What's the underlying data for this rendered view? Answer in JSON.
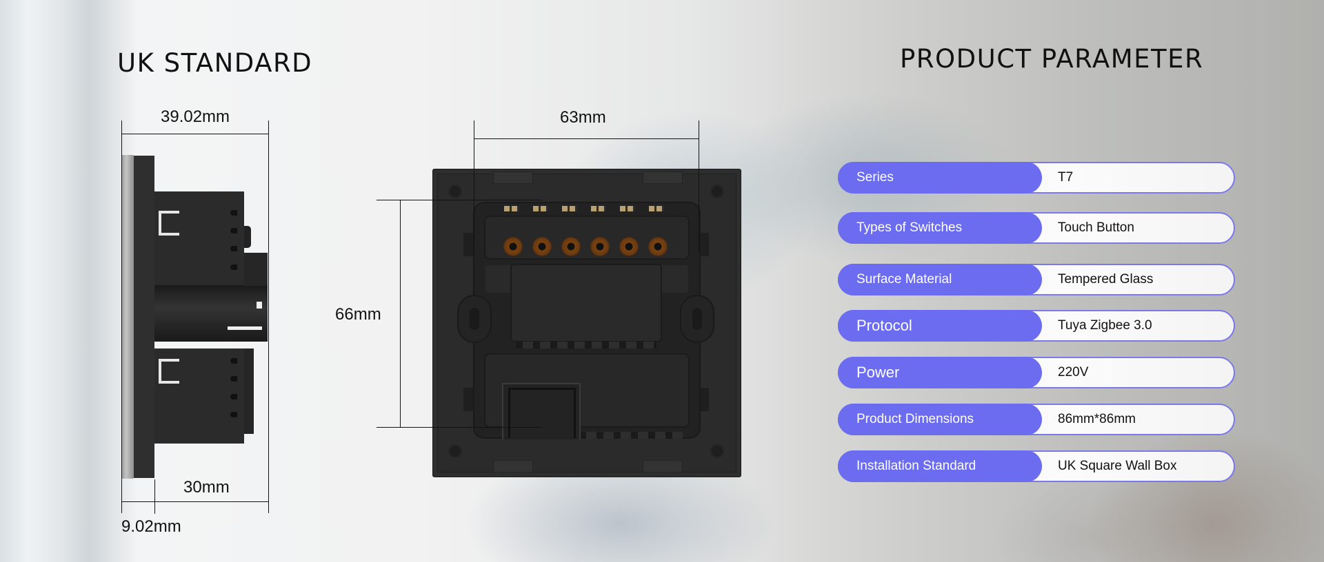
{
  "left_section": {
    "title": "UK STANDARD",
    "side_view": {
      "overall_depth": "39.02mm",
      "body_depth": "30mm",
      "panel_thickness": "9.02mm"
    },
    "back_view": {
      "width": "63mm",
      "height": "66mm",
      "terminal_count": 6
    }
  },
  "right_section": {
    "title": "PRODUCT PARAMETER",
    "accent_color": "#6b6cf0",
    "parameters": [
      {
        "label": "Series",
        "value": "T7"
      },
      {
        "label": "Types of Switches",
        "value": "Touch Button"
      },
      {
        "label": "Surface Material",
        "value": "Tempered Glass"
      },
      {
        "label": "Protocol",
        "value": "Tuya Zigbee 3.0"
      },
      {
        "label": "Power",
        "value": "220V"
      },
      {
        "label": "Product Dimensions",
        "value": "86mm*86mm"
      },
      {
        "label": "Installation Standard",
        "value": "UK Square Wall Box"
      }
    ]
  }
}
